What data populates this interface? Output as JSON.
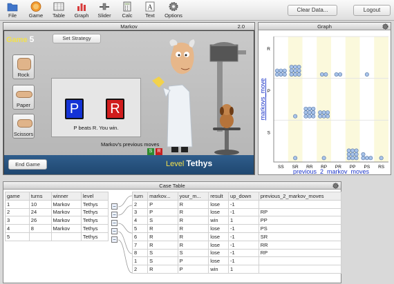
{
  "toolbar": {
    "items": [
      {
        "label": "File",
        "icon": "folder-icon"
      },
      {
        "label": "Game",
        "icon": "game-icon"
      },
      {
        "label": "Table",
        "icon": "table-icon"
      },
      {
        "label": "Graph",
        "icon": "bar-graph-icon"
      },
      {
        "label": "Slider",
        "icon": "slider-icon"
      },
      {
        "label": "Calc",
        "icon": "calculator-icon"
      },
      {
        "label": "Text",
        "icon": "text-icon"
      },
      {
        "label": "Options",
        "icon": "gear-icon"
      }
    ],
    "clear_label": "Clear Data...",
    "logout_label": "Logout"
  },
  "markov": {
    "title": "Markov",
    "version": "2.0",
    "game_label": "Game",
    "game_number": "5",
    "strategy_button": "Set Strategy",
    "rock": "Rock",
    "paper": "Paper",
    "scissors": "Scissors",
    "player_move": "P",
    "markov_move": "R",
    "result_text": "P beats R. You win.",
    "prev_label": "Markov's previous moves",
    "prev_moves": [
      "S",
      "R"
    ],
    "end_game": "End Game",
    "level_label": "Level",
    "level_value": "Tethys"
  },
  "graph": {
    "title": "Graph",
    "xlabel": "previous_2_markov_moves",
    "ylabel": "markovs_move"
  },
  "chart_data": {
    "type": "scatter",
    "xlabel": "previous_2_markov_moves",
    "ylabel": "markovs_move",
    "x_categories": [
      "SS",
      "SR",
      "RR",
      "RP",
      "PR",
      "PP",
      "PS",
      "RS"
    ],
    "y_categories": [
      "R",
      "P",
      "S"
    ],
    "counts": [
      {
        "x": "SS",
        "y": "R",
        "n": 6
      },
      {
        "x": "SR",
        "y": "R",
        "n": 9
      },
      {
        "x": "SR",
        "y": "P",
        "n": 1
      },
      {
        "x": "SR",
        "y": "S",
        "n": 1
      },
      {
        "x": "RR",
        "y": "P",
        "n": 9
      },
      {
        "x": "RP",
        "y": "R",
        "n": 2
      },
      {
        "x": "RP",
        "y": "P",
        "n": 6
      },
      {
        "x": "RP",
        "y": "S",
        "n": 1
      },
      {
        "x": "PR",
        "y": "R",
        "n": 2
      },
      {
        "x": "PP",
        "y": "S",
        "n": 9
      },
      {
        "x": "PS",
        "y": "R",
        "n": 1
      },
      {
        "x": "PS",
        "y": "S",
        "n": 4
      },
      {
        "x": "RS",
        "y": "S",
        "n": 1
      }
    ]
  },
  "case_table": {
    "title": "Case Table",
    "games_headers": [
      "game",
      "turns",
      "winner",
      "level"
    ],
    "games": [
      [
        "1",
        "10",
        "Markov",
        "Tethys"
      ],
      [
        "2",
        "24",
        "Markov",
        "Tethys"
      ],
      [
        "3",
        "26",
        "Markov",
        "Tethys"
      ],
      [
        "4",
        "8",
        "Markov",
        "Tethys"
      ],
      [
        "5",
        "",
        "",
        "Tethys"
      ]
    ],
    "turn_headers": [
      "turn",
      "markov...",
      "your_m...",
      "result",
      "up_down",
      "previous_2_markov_moves"
    ],
    "turns": [
      [
        "2",
        "P",
        "R",
        "lose",
        "-1",
        ""
      ],
      [
        "3",
        "P",
        "R",
        "lose",
        "-1",
        "RP"
      ],
      [
        "4",
        "S",
        "R",
        "win",
        "1",
        "PP"
      ],
      [
        "5",
        "R",
        "R",
        "lose",
        "-1",
        "PS"
      ],
      [
        "6",
        "R",
        "R",
        "lose",
        "-1",
        "SR"
      ],
      [
        "7",
        "R",
        "R",
        "lose",
        "-1",
        "RR"
      ],
      [
        "8",
        "S",
        "S",
        "lose",
        "-1",
        "RP"
      ],
      [
        "1",
        "S",
        "P",
        "lose",
        "-1",
        ""
      ],
      [
        "2",
        "R",
        "P",
        "win",
        "1",
        ""
      ]
    ]
  },
  "colors": {
    "player_card": "#1433d6",
    "markov_card": "#d11d1d",
    "level": "#f2e04c",
    "bubble": "#a9c4ea"
  }
}
